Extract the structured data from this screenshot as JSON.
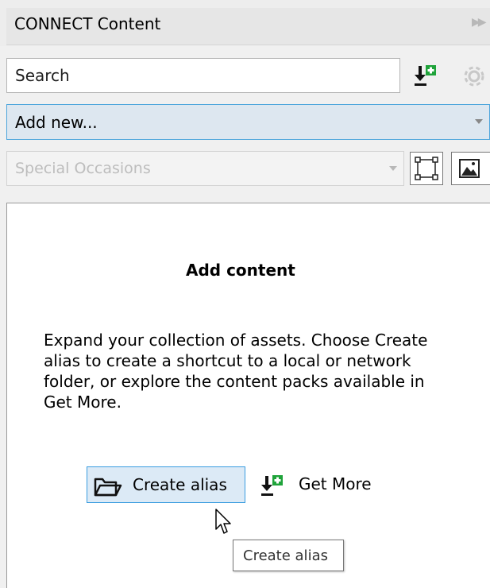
{
  "panel": {
    "title": "CONNECT Content"
  },
  "search": {
    "placeholder": "Search"
  },
  "add_new": {
    "label": "Add new..."
  },
  "category": {
    "selected": "Special Occasions"
  },
  "content": {
    "title": "Add content",
    "description": "Expand your collection of assets. Choose Create alias to create a shortcut to a local or network folder, or explore the content packs available in Get More."
  },
  "actions": {
    "create_alias_label": "Create alias",
    "get_more_label": "Get More"
  },
  "tooltip": {
    "text": "Create alias"
  },
  "icons": {
    "collapse": "double-chevron-right-icon",
    "download": "download-plus-icon",
    "settings": "gear-icon",
    "frame": "frame-icon",
    "image": "image-icon",
    "folder": "folder-icon",
    "cursor": "mouse-pointer-icon"
  },
  "colors": {
    "accent_border": "#3a9de0",
    "selected_fill": "#dceaf6",
    "add_icon_green": "#1fa33a"
  }
}
